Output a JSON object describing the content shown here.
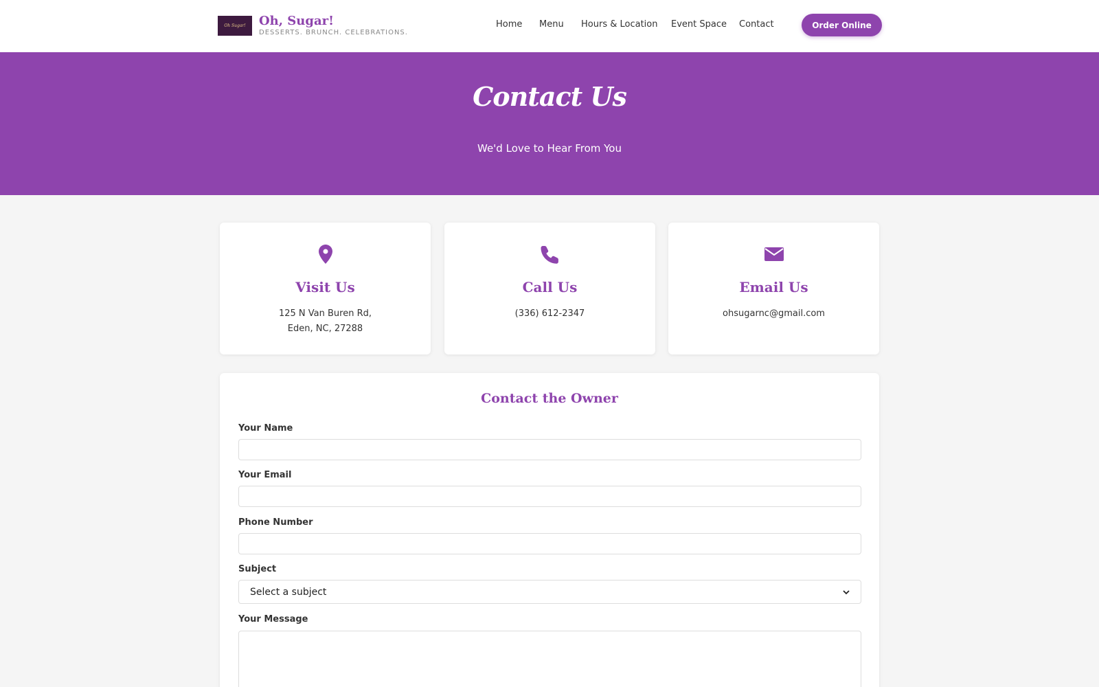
{
  "header": {
    "brand_name": "Oh, Sugar!",
    "brand_tagline": "DESSERTS. BRUNCH. CELEBRATIONS.",
    "logo_text": "Oh Sugar!",
    "nav": [
      {
        "label": "Home"
      },
      {
        "label": "Menu"
      },
      {
        "label": "Hours & Location"
      },
      {
        "label": "Event Space"
      },
      {
        "label": "Contact"
      }
    ],
    "order_label": "Order Online"
  },
  "hero": {
    "title": "Contact Us",
    "subtitle": "We'd Love to Hear From You"
  },
  "cards": [
    {
      "icon": "map-pin-icon",
      "title": "Visit Us",
      "line1": "125 N Van Buren Rd,",
      "line2": "Eden, NC, 27288"
    },
    {
      "icon": "phone-icon",
      "title": "Call Us",
      "line1": "(336) 612-2347"
    },
    {
      "icon": "envelope-icon",
      "title": "Email Us",
      "line1": "ohsugarnc@gmail.com"
    }
  ],
  "form": {
    "title": "Contact the Owner",
    "name_label": "Your Name",
    "email_label": "Your Email",
    "phone_label": "Phone Number",
    "subject_label": "Subject",
    "subject_selected": "Select a subject",
    "message_label": "Your Message"
  },
  "colors": {
    "brand_purple": "#8e44ad",
    "logo_bg": "#3d1a3f"
  }
}
